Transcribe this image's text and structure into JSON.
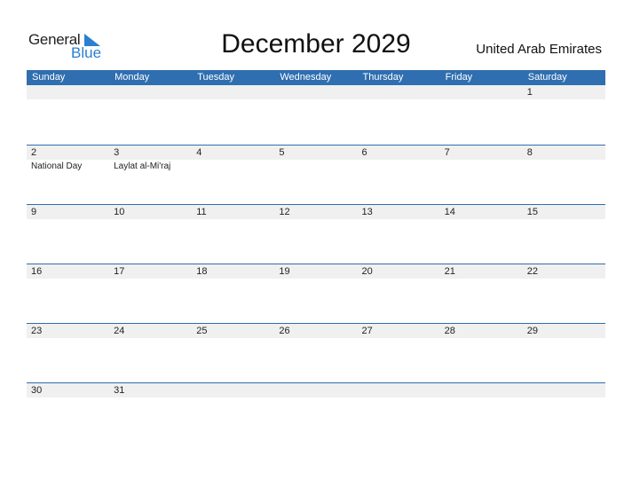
{
  "logo": {
    "general": "General",
    "blue": "Blue"
  },
  "title": "December 2029",
  "country": "United Arab Emirates",
  "colors": {
    "header_bg": "#2f6eb0",
    "day_bg": "#f0f0f0",
    "logo_blue": "#2a7fd0"
  },
  "weekdays": [
    "Sunday",
    "Monday",
    "Tuesday",
    "Wednesday",
    "Thursday",
    "Friday",
    "Saturday"
  ],
  "weeks": [
    [
      {
        "d": ""
      },
      {
        "d": ""
      },
      {
        "d": ""
      },
      {
        "d": ""
      },
      {
        "d": ""
      },
      {
        "d": ""
      },
      {
        "d": "1"
      }
    ],
    [
      {
        "d": "2",
        "ev": "National Day"
      },
      {
        "d": "3",
        "ev": "Laylat al-Mi'raj"
      },
      {
        "d": "4"
      },
      {
        "d": "5"
      },
      {
        "d": "6"
      },
      {
        "d": "7"
      },
      {
        "d": "8"
      }
    ],
    [
      {
        "d": "9"
      },
      {
        "d": "10"
      },
      {
        "d": "11"
      },
      {
        "d": "12"
      },
      {
        "d": "13"
      },
      {
        "d": "14"
      },
      {
        "d": "15"
      }
    ],
    [
      {
        "d": "16"
      },
      {
        "d": "17"
      },
      {
        "d": "18"
      },
      {
        "d": "19"
      },
      {
        "d": "20"
      },
      {
        "d": "21"
      },
      {
        "d": "22"
      }
    ],
    [
      {
        "d": "23"
      },
      {
        "d": "24"
      },
      {
        "d": "25"
      },
      {
        "d": "26"
      },
      {
        "d": "27"
      },
      {
        "d": "28"
      },
      {
        "d": "29"
      }
    ],
    [
      {
        "d": "30"
      },
      {
        "d": "31"
      },
      {
        "d": ""
      },
      {
        "d": ""
      },
      {
        "d": ""
      },
      {
        "d": ""
      },
      {
        "d": ""
      }
    ]
  ]
}
